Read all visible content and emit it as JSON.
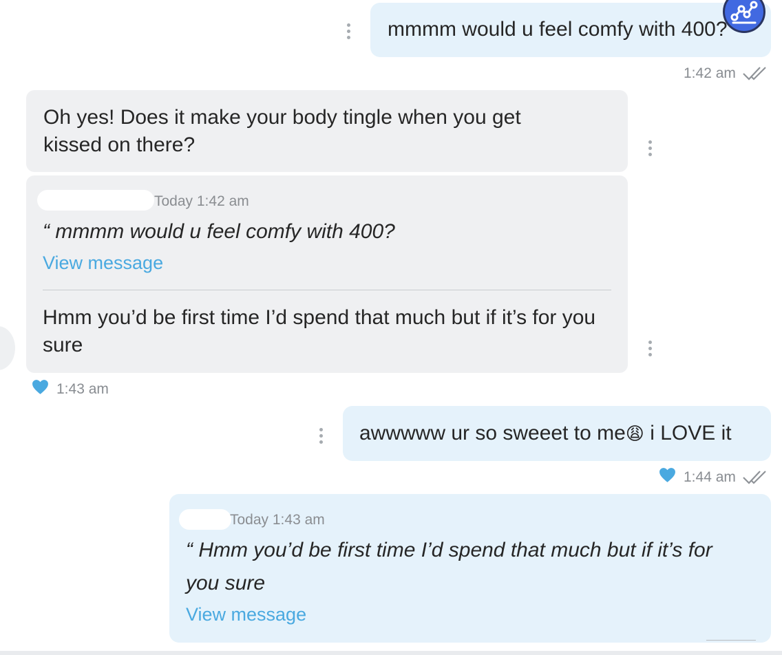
{
  "messages": {
    "m1": {
      "text": "mmmm would u feel comfy with 400?",
      "time": "1:42 am"
    },
    "m2": {
      "text": "Oh yes! Does it make your body tingle when you get kissed on there?"
    },
    "m3": {
      "quote_time": "Today 1:42 am",
      "quote_text": "“ mmmm would u feel comfy with 400?",
      "view_label": "View message",
      "text": "Hmm you’d be first time I’d spend that much but if it’s for you sure",
      "time": "1:43 am"
    },
    "m4": {
      "text_before": "awwwww ur so sweeet to me",
      "emoji": "😩",
      "text_after": " i LOVE it",
      "time": "1:44 am"
    },
    "m5": {
      "quote_time": "Today 1:43 am",
      "quote_text": "“ Hmm you’d be first time I’d spend that much but if it’s for you sure",
      "view_label": "View message"
    }
  },
  "icons": {
    "read_receipt": "double-check-icon",
    "liked": "heart-icon",
    "options": "more-vertical-icon",
    "app_badge": "graph-nodes-icon"
  },
  "colors": {
    "outgoing_bubble": "#e5f2fb",
    "incoming_bubble": "#eff0f2",
    "link": "#4aa9e0",
    "heart": "#4aa9e0",
    "badge": "#4169e1"
  }
}
